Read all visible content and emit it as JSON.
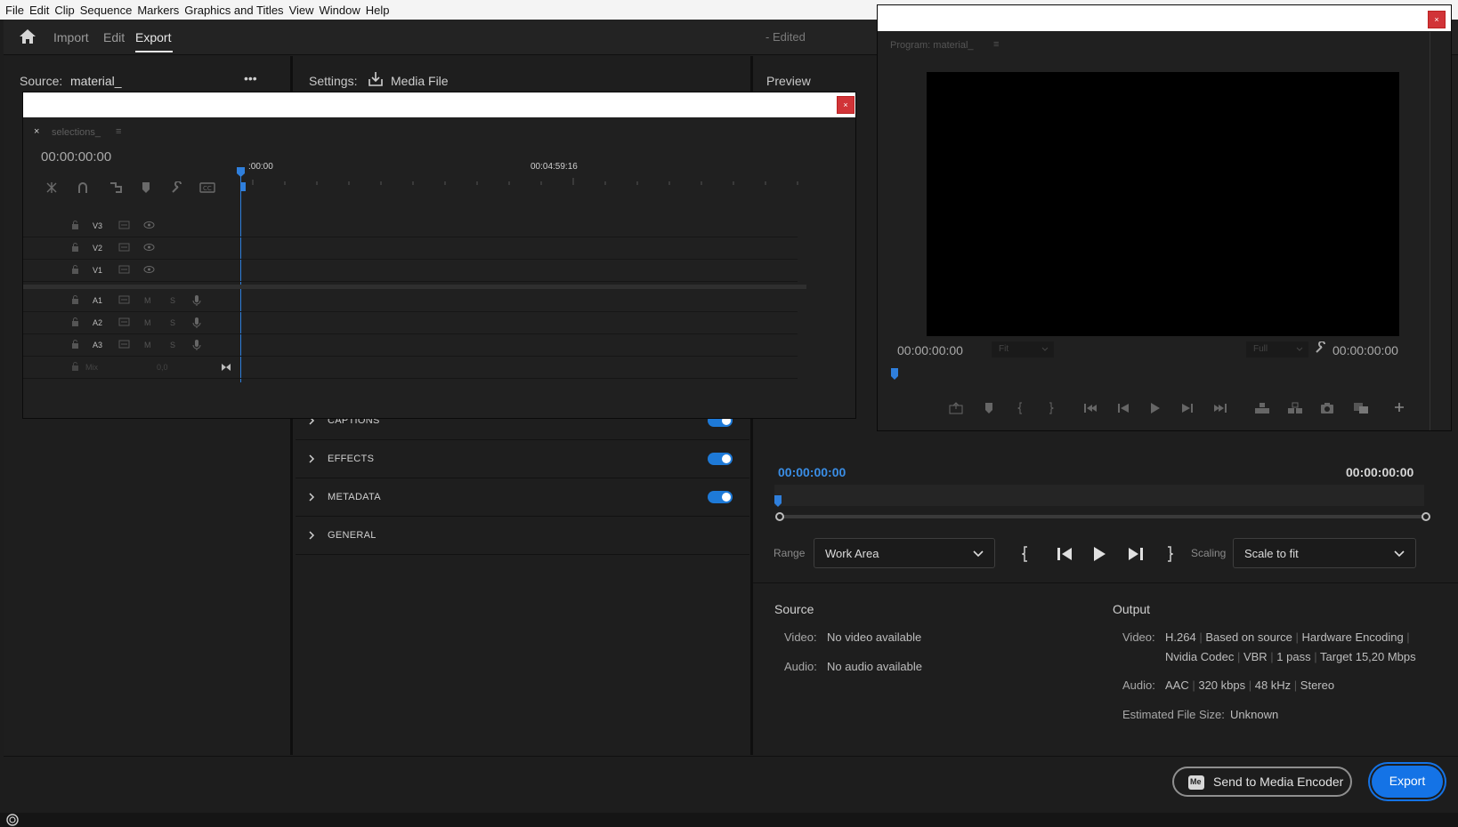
{
  "menu": [
    "File",
    "Edit",
    "Clip",
    "Sequence",
    "Markers",
    "Graphics and Titles",
    "View",
    "Window",
    "Help"
  ],
  "nav": {
    "import": "Import",
    "edit": "Edit",
    "export": "Export",
    "status": "- Edited"
  },
  "source": {
    "label": "Source:",
    "value": "material_",
    "more": "•••"
  },
  "settings": {
    "label": "Settings:",
    "target": "Media File"
  },
  "preview": {
    "label": "Preview"
  },
  "sections": [
    {
      "label": "CAPTIONS",
      "enabled": true
    },
    {
      "label": "EFFECTS",
      "enabled": true
    },
    {
      "label": "METADATA",
      "enabled": true
    },
    {
      "label": "GENERAL"
    }
  ],
  "timeline": {
    "tab_close": "×",
    "tab_name": "selections_",
    "tab_menu": "≡",
    "timecode": "00:00:00:00",
    "ruler_start": ":00:00",
    "ruler_mid": "00:04:59:16",
    "tracks_video": [
      "V3",
      "V2",
      "V1"
    ],
    "tracks_audio": [
      "A1",
      "A2",
      "A3"
    ],
    "mute": "M",
    "solo": "S",
    "mix_label": "Mix",
    "mix_value": "0,0"
  },
  "program": {
    "title": "Program: material_",
    "menu": "≡",
    "timecode_left": "00:00:00:00",
    "fit": "Fit",
    "quality": "Full",
    "timecode_right": "00:00:00:00"
  },
  "preview_panel": {
    "timecode_current": "00:00:00:00",
    "timecode_end": "00:00:00:00",
    "range_label": "Range",
    "range_value": "Work Area",
    "scaling_label": "Scaling",
    "scaling_value": "Scale to fit"
  },
  "summary": {
    "source_title": "Source",
    "source_video_label": "Video:",
    "source_video": "No video available",
    "source_audio_label": "Audio:",
    "source_audio": "No audio available",
    "output_title": "Output",
    "out_video_label": "Video:",
    "out_video_1": "H.264",
    "out_video_2": "Based on source",
    "out_video_3": "Hardware Encoding",
    "out_video_4": "Nvidia Codec",
    "out_video_5": "VBR",
    "out_video_6": "1 pass",
    "out_video_7": "Target 15,20 Mbps",
    "out_audio_label": "Audio:",
    "out_audio_1": "AAC",
    "out_audio_2": "320 kbps",
    "out_audio_3": "48 kHz",
    "out_audio_4": "Stereo",
    "size_label": "Estimated File Size:",
    "size_value": "Unknown"
  },
  "buttons": {
    "media_encoder": "Send to Media Encoder",
    "media_encoder_badge": "Me",
    "export": "Export"
  },
  "close_glyph": "×",
  "colors": {
    "accent": "#1473e6",
    "toggle": "#1e7ad8",
    "timecode_blue": "#3a8ee6",
    "close": "#d13438"
  }
}
